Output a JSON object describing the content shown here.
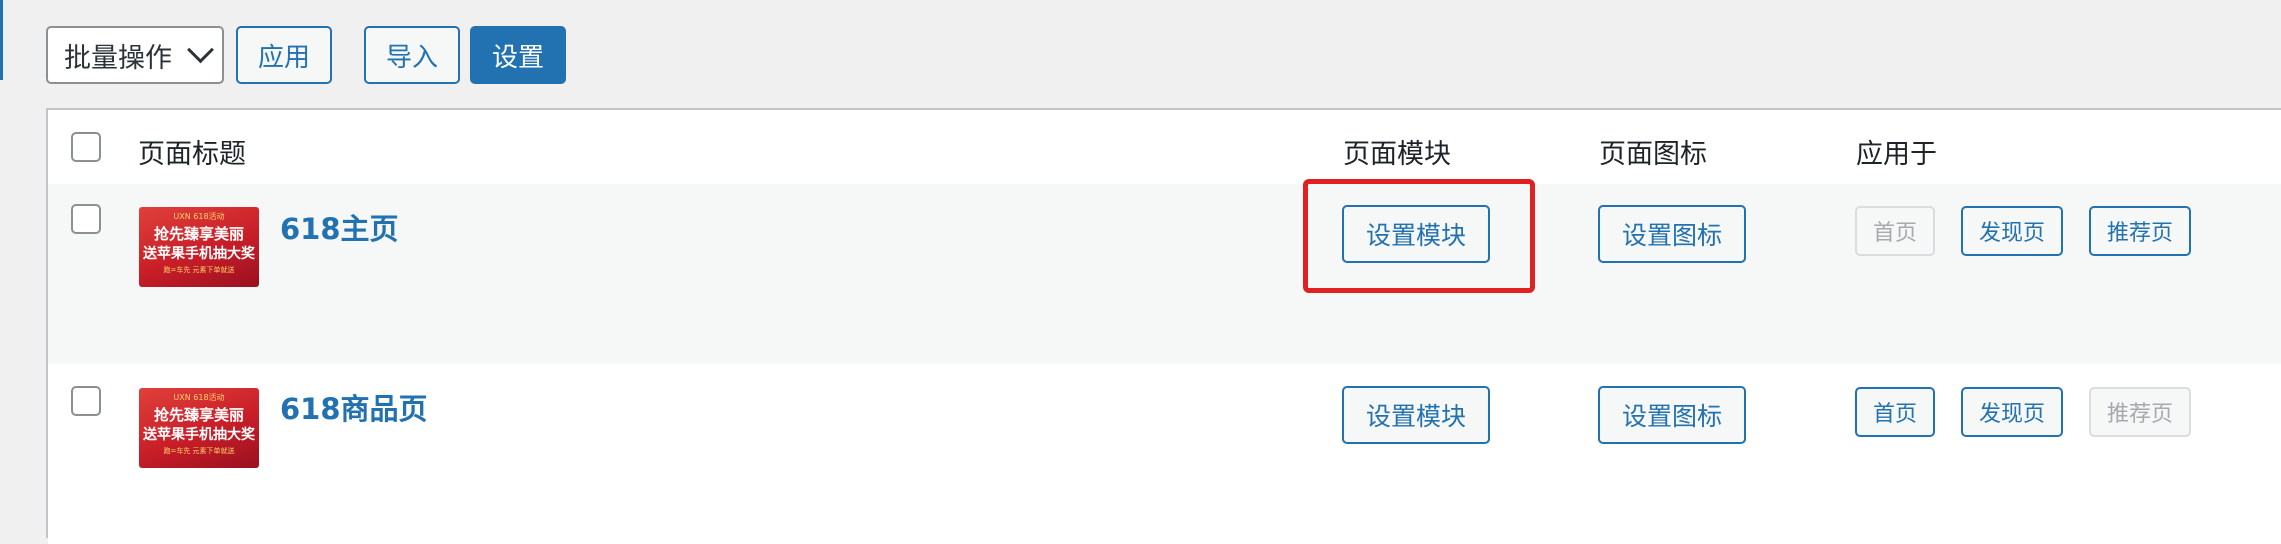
{
  "toolbar": {
    "bulk_action_label": "批量操作",
    "apply_label": "应用",
    "import_label": "导入",
    "settings_label": "设置"
  },
  "table": {
    "columns": {
      "title": "页面标题",
      "module": "页面模块",
      "icon": "页面图标",
      "applies_to": "应用于"
    },
    "rows": [
      {
        "title": "618主页",
        "thumb": {
          "brand": "UXN 618活动",
          "line1": "抢先臻享美丽",
          "line2": "送苹果手机抽大奖",
          "line3": "跑=车先 元素下单就送"
        },
        "set_module": "设置模块",
        "set_icon": "设置图标",
        "home": "首页",
        "discover": "发现页",
        "recommend": "推荐页"
      },
      {
        "title": "618商品页",
        "thumb": {
          "brand": "UXN 618活动",
          "line1": "抢先臻享美丽",
          "line2": "送苹果手机抽大奖",
          "line3": "跑=车先 元素下单就送"
        },
        "set_module": "设置模块",
        "set_icon": "设置图标",
        "home": "首页",
        "discover": "发现页",
        "recommend": "推荐页"
      }
    ]
  },
  "colors": {
    "accent": "#2271b1",
    "highlight": "#e02121",
    "disabled": "#a7aaad"
  }
}
